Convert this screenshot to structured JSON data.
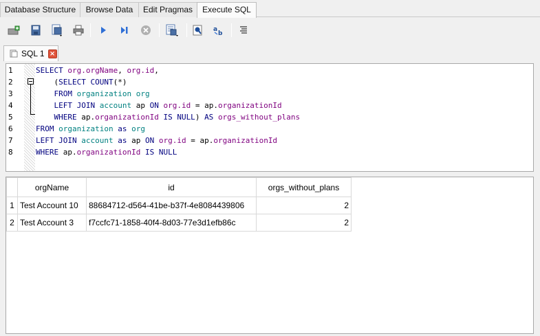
{
  "top_tabs": [
    {
      "label": "Database Structure",
      "active": false
    },
    {
      "label": "Browse Data",
      "active": false
    },
    {
      "label": "Edit Pragmas",
      "active": false
    },
    {
      "label": "Execute SQL",
      "active": true
    }
  ],
  "toolbar": {
    "icons": [
      "open-tab-icon",
      "open-sql-file-icon",
      "save-sql-file-icon",
      "print-icon",
      "execute-all-icon",
      "execute-line-icon",
      "stop-icon",
      "save-results-icon",
      "find-icon",
      "find-replace-icon",
      "comment-icon"
    ]
  },
  "sql_tab": {
    "label": "SQL 1",
    "close": "×"
  },
  "editor": {
    "line_numbers": [
      "1",
      "2",
      "3",
      "4",
      "5",
      "6",
      "7",
      "8"
    ],
    "lines": [
      [
        [
          "kw",
          "SELECT "
        ],
        [
          "id",
          "org.orgName"
        ],
        [
          "op",
          ", "
        ],
        [
          "id",
          "org.id"
        ],
        [
          "op",
          ","
        ]
      ],
      [
        [
          "op",
          "    ("
        ],
        [
          "kw",
          "SELECT "
        ],
        [
          "kw",
          "COUNT"
        ],
        [
          "op",
          "(*)"
        ]
      ],
      [
        [
          "kw",
          "    FROM "
        ],
        [
          "tbl",
          "organization"
        ],
        [
          "op",
          " "
        ],
        [
          "tbl",
          "org"
        ]
      ],
      [
        [
          "kw",
          "    LEFT JOIN "
        ],
        [
          "tbl",
          "account"
        ],
        [
          "op",
          " ap "
        ],
        [
          "kw",
          "ON "
        ],
        [
          "id",
          "org.id"
        ],
        [
          "op",
          " = ap."
        ],
        [
          "id",
          "organizationId"
        ]
      ],
      [
        [
          "kw",
          "    WHERE "
        ],
        [
          "op",
          "ap."
        ],
        [
          "id",
          "organizationId"
        ],
        [
          "kw",
          " IS NULL"
        ],
        [
          "op",
          ") "
        ],
        [
          "kw",
          "AS "
        ],
        [
          "id",
          "orgs_without_plans"
        ]
      ],
      [
        [
          "kw",
          "FROM "
        ],
        [
          "tbl",
          "organization"
        ],
        [
          "kw",
          " as "
        ],
        [
          "tbl",
          "org"
        ]
      ],
      [
        [
          "kw",
          "LEFT JOIN "
        ],
        [
          "tbl",
          "account"
        ],
        [
          "kw",
          " as "
        ],
        [
          "op",
          "ap "
        ],
        [
          "kw",
          "ON "
        ],
        [
          "id",
          "org.id"
        ],
        [
          "op",
          " = ap."
        ],
        [
          "id",
          "organizationId"
        ]
      ],
      [
        [
          "kw",
          "WHERE "
        ],
        [
          "op",
          "ap."
        ],
        [
          "id",
          "organizationId"
        ],
        [
          "kw",
          " IS NULL"
        ]
      ]
    ]
  },
  "results": {
    "columns": [
      "orgName",
      "id",
      "orgs_without_plans"
    ],
    "rows": [
      {
        "n": "1",
        "cells": [
          "Test Account 10",
          "88684712-d564-41be-b37f-4e8084439806",
          "2"
        ]
      },
      {
        "n": "2",
        "cells": [
          "Test Account 3",
          "f7ccfc71-1858-40f4-8d03-77e3d1efb86c",
          "2"
        ]
      }
    ]
  },
  "colors": {
    "keyword": "#00007f",
    "identifier": "#7f007f",
    "table": "#008080",
    "close": "#e0533a"
  }
}
